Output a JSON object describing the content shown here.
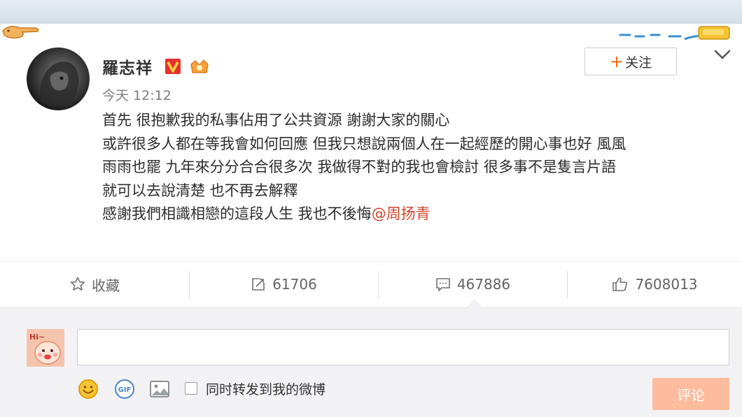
{
  "post": {
    "username": "羅志祥",
    "verified_badge": "V",
    "time": "今天 12:12",
    "follow_label": "关注",
    "lines": [
      "首先 很抱歉我的私事佔用了公共資源 謝謝大家的關心",
      "或許很多人都在等我會如何回應 但我只想說兩個人在一起經歷的開心事也好 風風",
      "雨雨也罷 九年來分分合合很多次 我做得不對的我也會檢討 很多事不是隻言片語",
      "就可以去說清楚 也不再去解釋",
      "感謝我們相識相戀的這段人生 我也不後悔"
    ],
    "mention": "@周扬青"
  },
  "actions": {
    "favorite_label": "收藏",
    "repost_count": "61706",
    "comment_count": "467886",
    "like_count": "7608013"
  },
  "comment_box": {
    "avatar_text": "Hi~",
    "repost_checkbox_label": "同时转发到我的微博",
    "submit_label": "评论",
    "gif_label": "GIF"
  },
  "colors": {
    "accent_orange": "#f06a0c",
    "mention_red": "#d2462c",
    "submit_disabled": "#fdbc9e",
    "vip_red": "#e8302e"
  },
  "icons": [
    "lion-avatar",
    "verified-v-icon",
    "vip-crown-icon",
    "plus-icon",
    "chevron-down-icon",
    "star-icon",
    "repost-icon",
    "comment-icon",
    "thumbs-up-icon",
    "emoji-icon",
    "gif-icon",
    "image-icon"
  ]
}
